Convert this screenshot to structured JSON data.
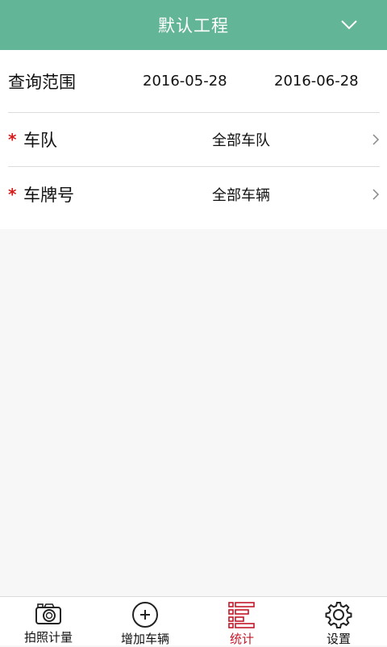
{
  "header": {
    "title": "默认工程",
    "dropdown_icon": "chevron-down-icon"
  },
  "query": {
    "range_label": "查询范围",
    "start_date": "2016-05-28",
    "end_date": "2016-06-28"
  },
  "fields": {
    "required_mark": "*",
    "team_label": "车队",
    "team_value": "全部车队",
    "plate_label": "车牌号",
    "plate_value": "全部车辆"
  },
  "tabs": [
    {
      "label": "拍照计量",
      "icon": "camera-icon",
      "active": false
    },
    {
      "label": "增加车辆",
      "icon": "add-circle-icon",
      "active": false
    },
    {
      "label": "统计",
      "icon": "list-stats-icon",
      "active": true
    },
    {
      "label": "设置",
      "icon": "gear-icon",
      "active": false
    }
  ],
  "colors": {
    "header_bg": "#63b597",
    "active_tab": "#c2182a",
    "required": "#d61a1a"
  }
}
